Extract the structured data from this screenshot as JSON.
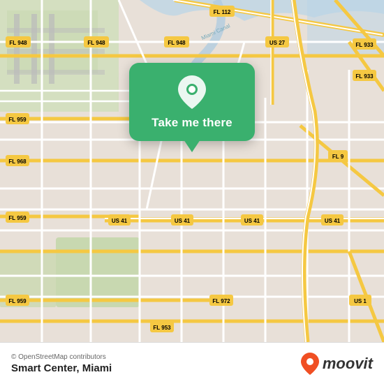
{
  "map": {
    "background_color": "#e8e0d8",
    "road_color": "#ffffff",
    "highway_color": "#f5c842",
    "water_color": "#b0d0e8",
    "green_color": "#c8dbb0"
  },
  "popup": {
    "background": "#3ab06e",
    "button_label": "Take me there"
  },
  "bottom_bar": {
    "copyright": "© OpenStreetMap contributors",
    "place_name": "Smart Center, Miami",
    "moovit_label": "moovit"
  },
  "road_labels": [
    "FL 948",
    "FL 948",
    "FL 948",
    "FL 112",
    "US 27",
    "FL 933",
    "FL 959",
    "FL 9",
    "FL 968",
    "US 41",
    "US 41",
    "US 41",
    "US 41",
    "FL 959",
    "FL 972",
    "FL 953",
    "US 1"
  ]
}
